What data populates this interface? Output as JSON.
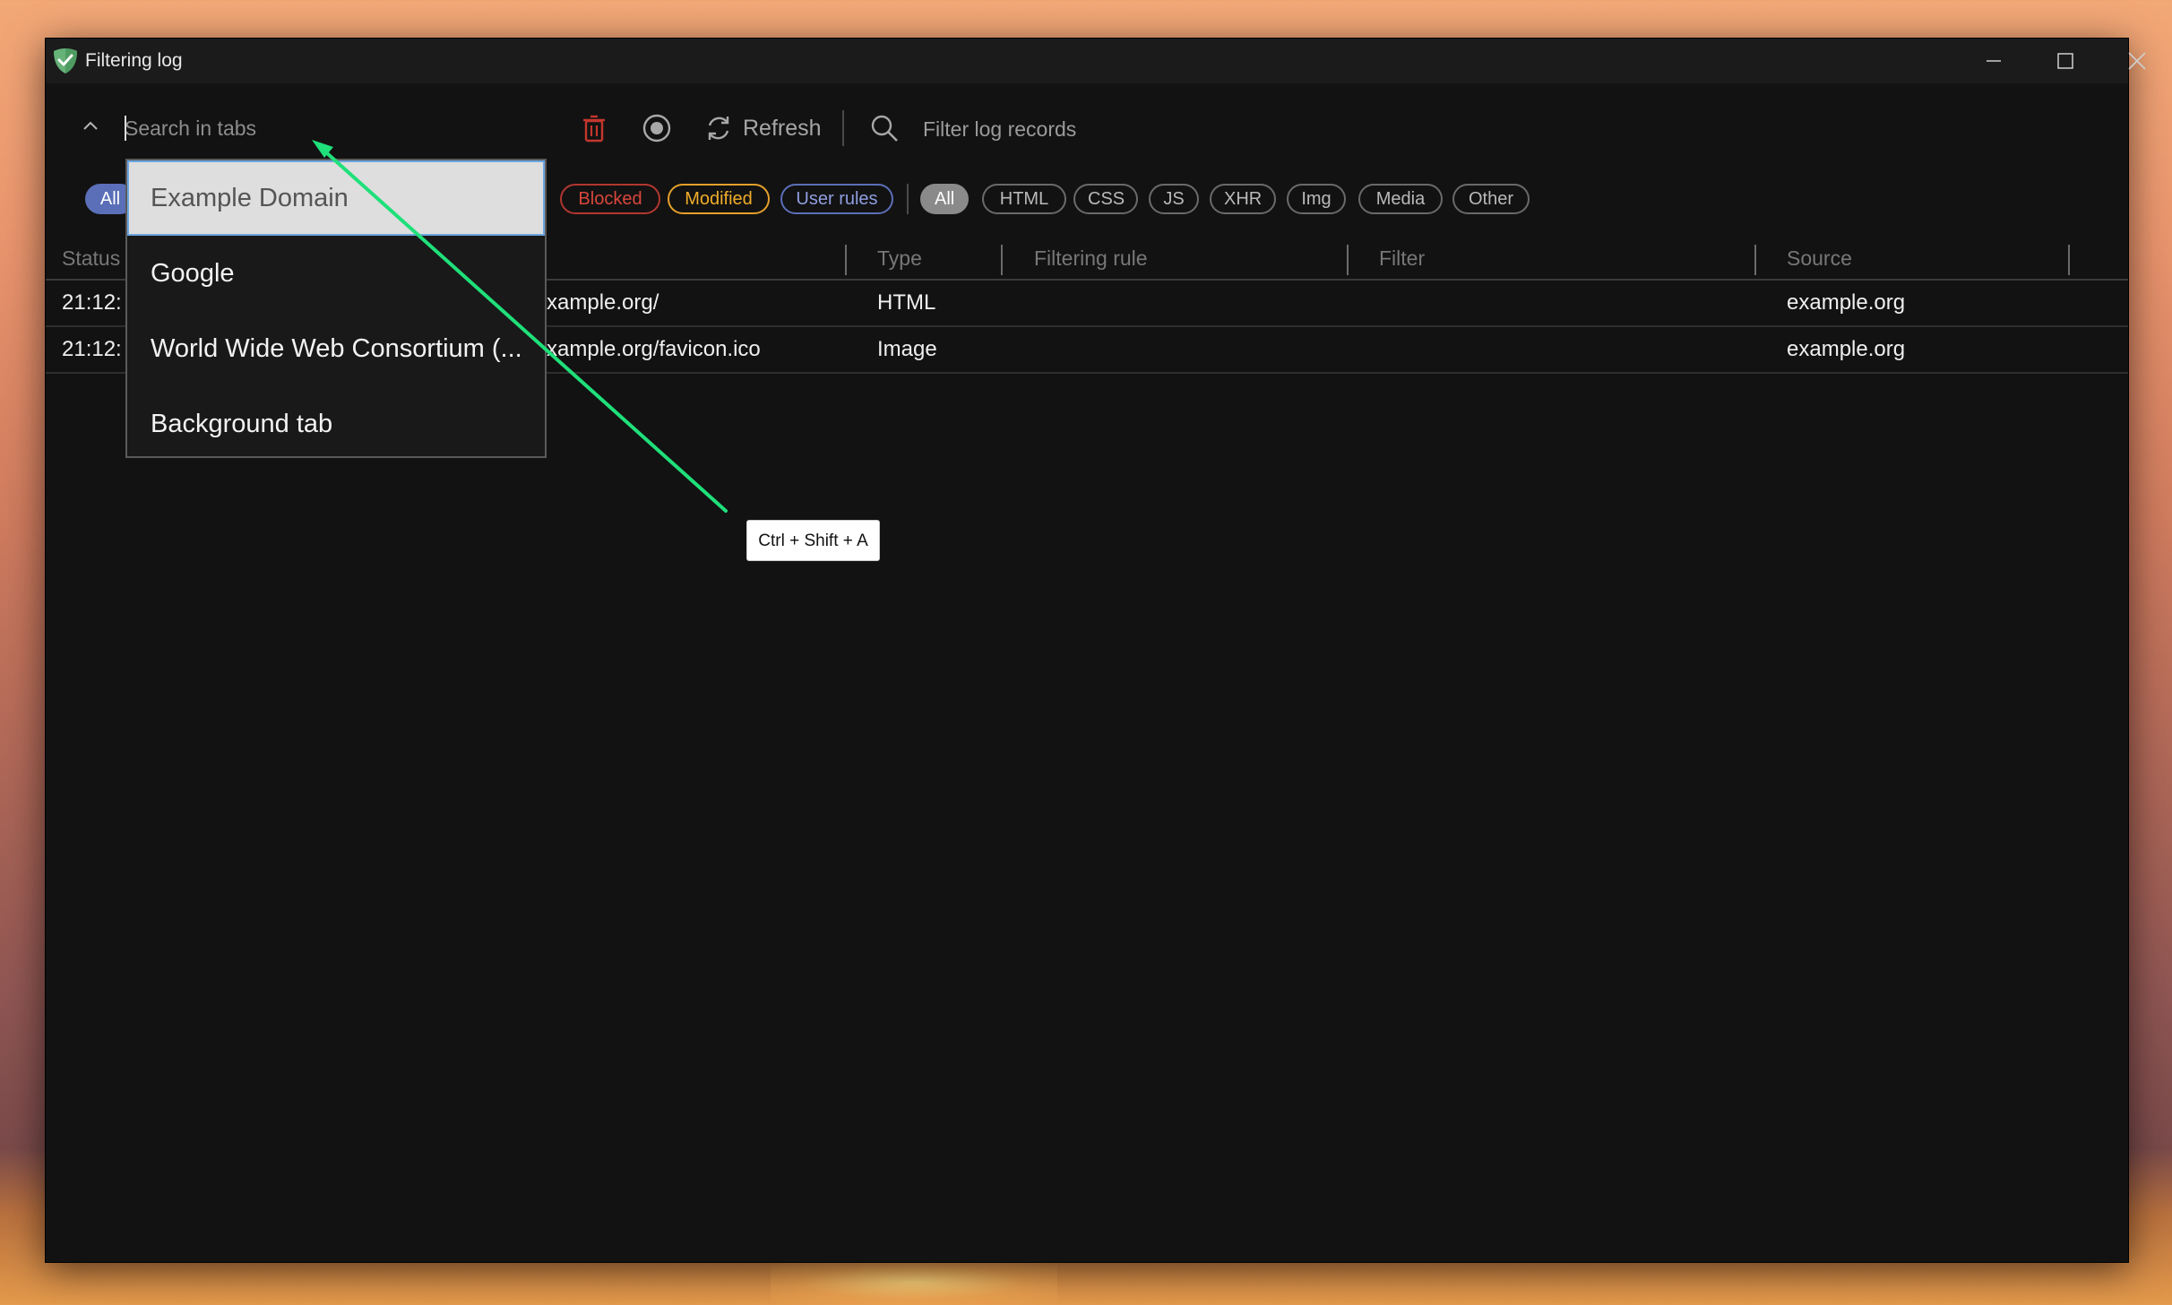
{
  "window": {
    "title": "Filtering log"
  },
  "toolbar": {
    "search_placeholder": "Search in tabs",
    "refresh_label": "Refresh",
    "filter_placeholder": "Filter log records"
  },
  "status_filters": {
    "all": "All",
    "blocked": "Blocked",
    "modified": "Modified",
    "user_rules": "User rules"
  },
  "type_filters": [
    "All",
    "HTML",
    "CSS",
    "JS",
    "XHR",
    "Img",
    "Media",
    "Other"
  ],
  "table": {
    "columns": {
      "status": "Status",
      "type": "Type",
      "filtering_rule": "Filtering rule",
      "filter": "Filter",
      "source": "Source"
    },
    "rows": [
      {
        "time": "21:12:",
        "url": "xample.org/",
        "type": "HTML",
        "source": "example.org"
      },
      {
        "time": "21:12:",
        "url": "xample.org/favicon.ico",
        "type": "Image",
        "source": "example.org"
      }
    ]
  },
  "tab_dropdown": {
    "items": [
      "Example Domain",
      "Google",
      "World Wide Web Consortium (...",
      "Background tab"
    ],
    "selected_index": 0
  },
  "annotation": {
    "shortcut": "Ctrl + Shift + A",
    "arrow_color": "#1fe07a"
  },
  "colors": {
    "accent_blue": "#5b6fb8",
    "blocked_red": "#d9473d",
    "modified_orange": "#f0ad2b",
    "brand_green": "#67b279"
  }
}
